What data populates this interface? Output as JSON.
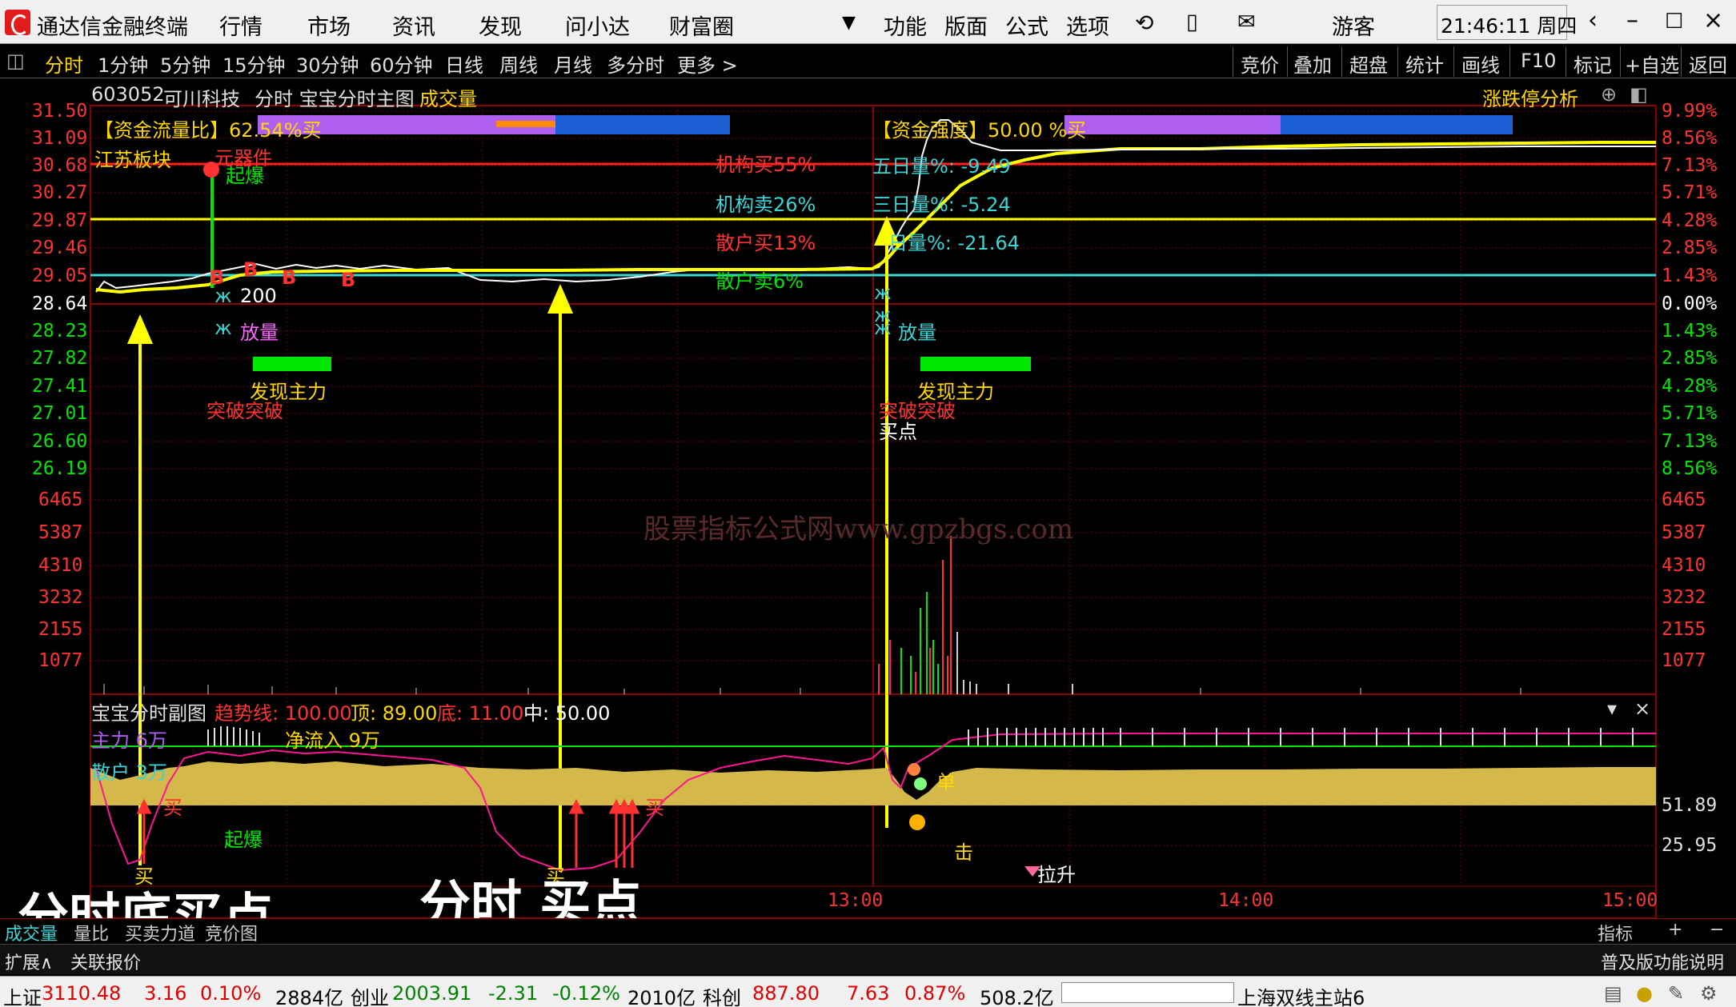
{
  "menu": {
    "app_title": "通达信金融终端",
    "items": [
      "行情",
      "市场",
      "资讯",
      "发现",
      "问小达",
      "财富圈"
    ],
    "right_items": [
      "功能",
      "版面",
      "公式",
      "选项"
    ],
    "user": "游客",
    "clock": "21:46:11 周四"
  },
  "tabs": {
    "period": [
      "分时",
      "1分钟",
      "5分钟",
      "15分钟",
      "30分钟",
      "60分钟",
      "日线",
      "周线",
      "月线",
      "多分时",
      "更多 >"
    ],
    "tools": [
      "竞价",
      "叠加",
      "超盘",
      "统计",
      "画线",
      "F10",
      "标记",
      "+自选",
      "返回"
    ]
  },
  "stock": {
    "code": "603052",
    "name": "可川科技",
    "chart": "分时 宝宝分时主图",
    "volume_label": "成交量",
    "analysis": "涨跌停分析"
  },
  "price_axis": {
    "left": [
      "31.50",
      "31.09",
      "30.68",
      "30.27",
      "29.87",
      "29.46",
      "29.05",
      "28.64",
      "28.23",
      "27.82",
      "27.41",
      "27.01",
      "26.60",
      "26.19"
    ],
    "right": [
      "9.99%",
      "8.56%",
      "7.13%",
      "5.71%",
      "4.28%",
      "2.85%",
      "1.43%",
      "0.00%",
      "1.43%",
      "2.85%",
      "4.28%",
      "5.71%",
      "7.13%",
      "8.56%"
    ]
  },
  "volume_axis": {
    "labels": [
      "6465",
      "5387",
      "4310",
      "3232",
      "2155",
      "1077"
    ]
  },
  "sub_axis": {
    "labels": [
      "51.89",
      "25.95"
    ]
  },
  "time_axis": [
    "13:00",
    "14:00",
    "15:00"
  ],
  "annotations": {
    "flow_left": "【资金流量比】62.54%买",
    "flow_right": "【资金强度】50.00 %买",
    "sector": "江苏板块",
    "component": "元器件",
    "qibao": "起爆",
    "inst_buy": "机构买55%",
    "inst_sell": "机构卖26%",
    "retail_buy": "散户买13%",
    "retail_sell": "散户卖6%",
    "five_day": "五日量%: -9.49",
    "three_day": "三日量%: -5.24",
    "one_day": "日量%: -21.64",
    "vol200": "200",
    "fangliang": "放量",
    "faxian": "发现主力",
    "tupo": "突破突破",
    "maidian": "买点",
    "watermark": "股票指标公式网www.gpzbgs.com"
  },
  "sub_chart": {
    "title": "宝宝分时副图",
    "trend": "趋势线: 100.00",
    "top": "顶: 89.00",
    "bottom": "底: 11.00",
    "mid": "中: 50.00",
    "zhuli": "主力 6万",
    "jingliu": "净流入 9万",
    "sanhu": "散户 3万",
    "buy": "买",
    "qibao": "起爆",
    "dan": "单",
    "ji": "击",
    "lasheng": "拉升"
  },
  "overlay_text": {
    "left": "分时底买点",
    "right": "分时 买点"
  },
  "bottom_tabs": [
    "成交量",
    "量比",
    "买卖力道",
    "竞价图"
  ],
  "bottom_right": [
    "指标",
    "+",
    "−"
  ],
  "expand": {
    "label": "扩展∧",
    "related": "关联报价",
    "edition": "普及版功能说明"
  },
  "status": {
    "sh_label": "上证",
    "sh_val": "3110.48",
    "sh_chg": "3.16",
    "sh_pct": "0.10%",
    "sh_amt": "2884亿",
    "cy_label": "创业",
    "cy_val": "2003.91",
    "cy_chg": "-2.31",
    "cy_pct": "-0.12%",
    "cy_amt": "2010亿",
    "kc_label": "科创",
    "kc_val": "887.80",
    "kc_chg": "7.63",
    "kc_pct": "0.87%",
    "kc_amt": "508.2亿",
    "server": "上海双线主站6"
  },
  "colors": {
    "up": "#ff3232",
    "down": "#00e600",
    "price": "#ffffff",
    "avg": "#ffff00",
    "zhuli": "#d4b94a"
  }
}
